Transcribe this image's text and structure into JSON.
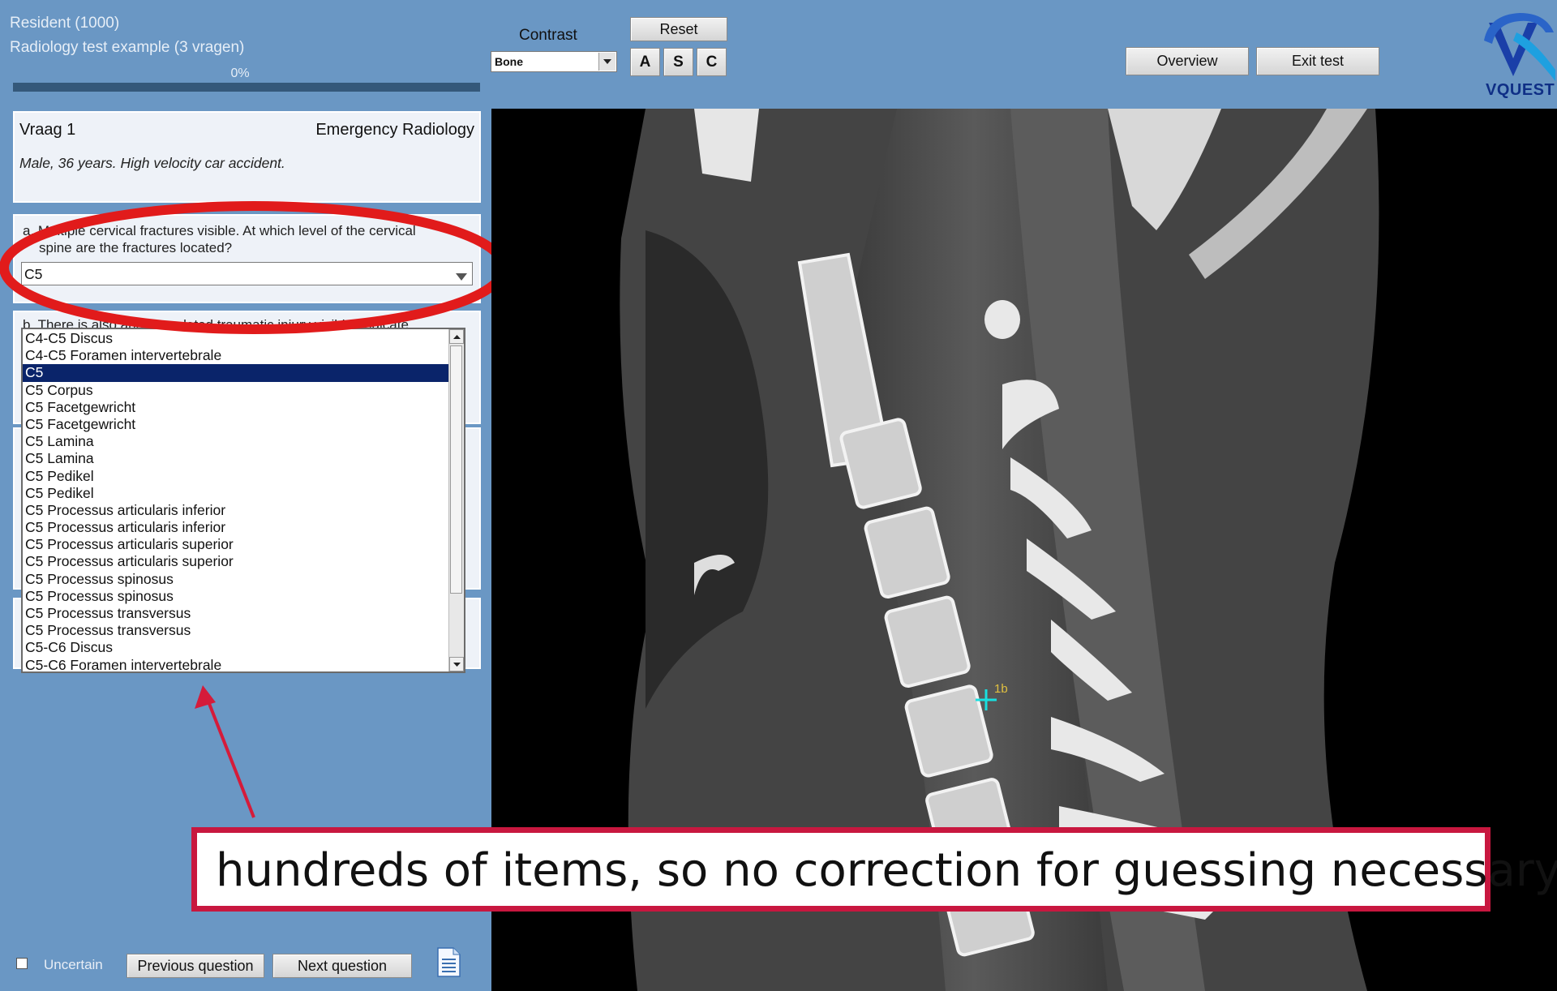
{
  "header": {
    "user": "Resident (1000)",
    "test_name": "Radiology test example (3 vragen)",
    "progress_label": "0%",
    "progress": 0
  },
  "contrast": {
    "label": "Contrast",
    "selected": "Bone",
    "reset_label": "Reset",
    "view_buttons": [
      "A",
      "S",
      "C"
    ]
  },
  "nav": {
    "overview_label": "Overview",
    "exit_label": "Exit test"
  },
  "logo": {
    "text": "VQUEST"
  },
  "question": {
    "number": "Vraag 1",
    "category": "Emergency Radiology",
    "case": "Male, 36 years. High velocity car accident."
  },
  "question_a": {
    "prefix": "a.",
    "line1": "Multiple cervical fractures visible. At which level of the cervical",
    "line2": "spine are the fractures located?",
    "answer": "C5"
  },
  "question_b": {
    "partial": "b. There is also another related traumatic injury visible. Indicate"
  },
  "dropdown_options": [
    "C4-C5 Discus",
    "C4-C5 Foramen intervertebrale",
    "C5",
    "C5 Corpus",
    "C5 Facetgewricht",
    "C5 Facetgewricht",
    "C5 Lamina",
    "C5 Lamina",
    "C5 Pedikel",
    "C5 Pedikel",
    "C5 Processus articularis inferior",
    "C5 Processus articularis inferior",
    "C5 Processus articularis superior",
    "C5 Processus articularis superior",
    "C5 Processus spinosus",
    "C5 Processus spinosus",
    "C5 Processus transversus",
    "C5 Processus transversus",
    "C5-C6 Discus",
    "C5-C6 Foramen intervertebrale"
  ],
  "dropdown_selected_index": 2,
  "viewer": {
    "marker_label": "1b"
  },
  "footer": {
    "uncertain_label": "Uncertain",
    "prev_label": "Previous question",
    "next_label": "Next question"
  },
  "annotation": {
    "text": "hundreds of items, so no correction for guessing necessary"
  },
  "colors": {
    "background": "#6a97c4",
    "selected_item": "#0a246a",
    "annotation_red": "#c8173f",
    "marker_cyan": "#18e0e0"
  }
}
